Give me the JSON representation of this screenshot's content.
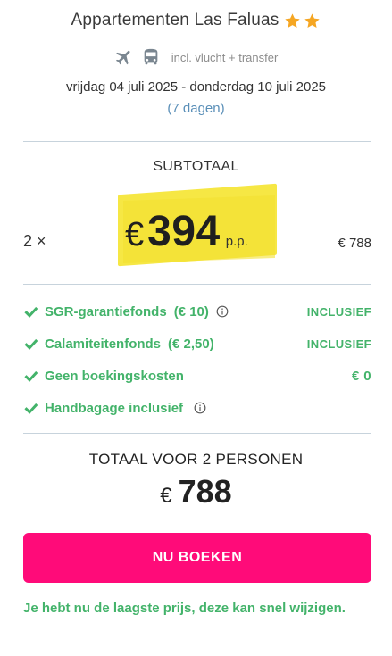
{
  "hotel": {
    "name": "Appartementen Las Faluas",
    "stars": 2,
    "star_color": "#f5a623"
  },
  "travel": {
    "icons": [
      "airplane-icon",
      "bus-icon"
    ],
    "description": "incl. vlucht + transfer"
  },
  "period": {
    "dates": "vrijdag 04 juli 2025 - donderdag 10 juli 2025",
    "duration": "(7 dagen)"
  },
  "subtotal": {
    "label": "SUBTOTAAL",
    "quantity": "2 ×",
    "currency": "€",
    "price_per_person": "394",
    "per_person_label": "p.p.",
    "total": "€ 788"
  },
  "features": [
    {
      "label": "SGR-garantiefonds",
      "extra": "(€ 10)",
      "info": true,
      "value": "INCLUSIEF"
    },
    {
      "label": "Calamiteitenfonds",
      "extra": "(€ 2,50)",
      "info": false,
      "value": "INCLUSIEF"
    },
    {
      "label": "Geen boekingskosten",
      "extra": "",
      "info": false,
      "value": "€ 0"
    },
    {
      "label": "Handbagage inclusief",
      "extra": "",
      "info": true,
      "value": ""
    }
  ],
  "total": {
    "label": "TOTAAL VOOR 2 PERSONEN",
    "currency": "€",
    "amount": "788"
  },
  "cta": {
    "label": "NU BOEKEN",
    "color": "#ff0b79"
  },
  "notice": "Je hebt nu de laagste prijs, deze kan snel wijzigen.",
  "colors": {
    "accent_green": "#43b36a",
    "highlight_yellow": "#f6e744",
    "link_blue": "#5a8fb8"
  }
}
